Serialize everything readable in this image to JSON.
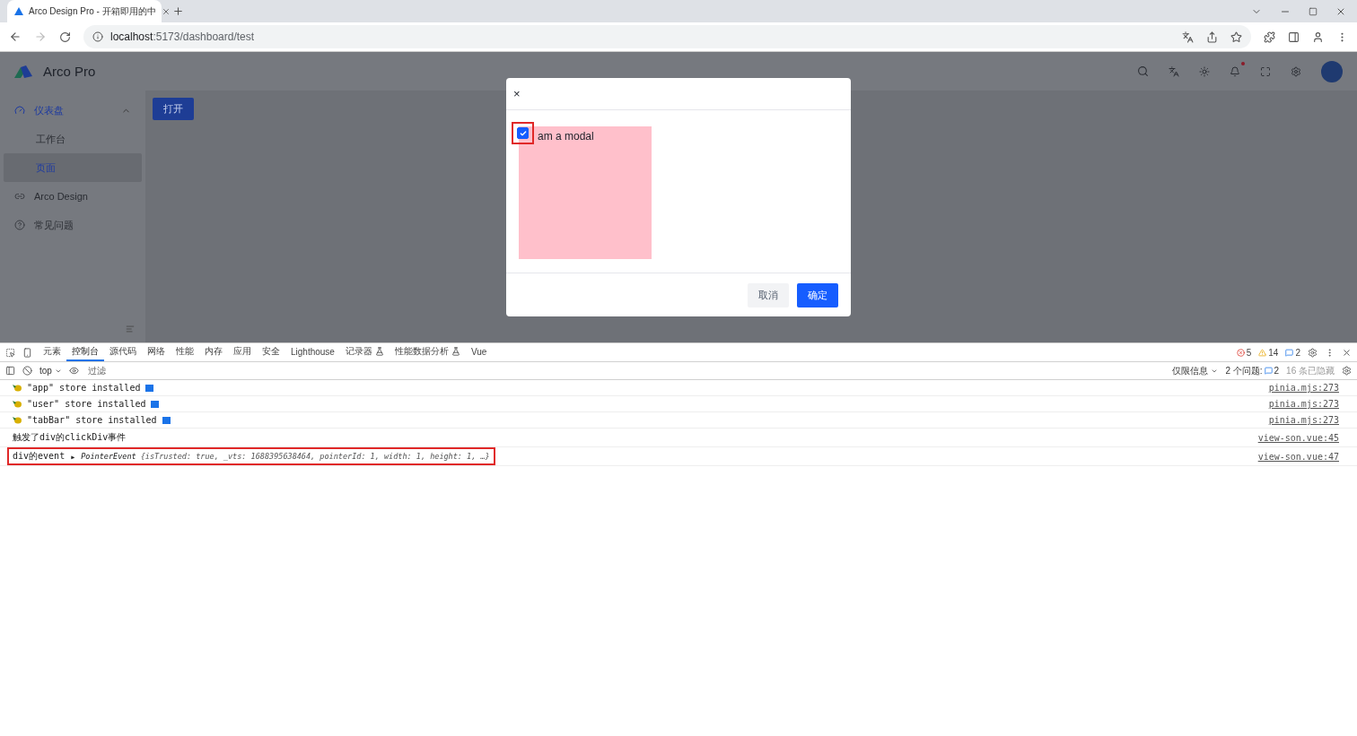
{
  "browser": {
    "tab_title": "Arco Design Pro - 开箱即用的中",
    "url_host": "localhost",
    "url_path": ":5173/dashboard/test"
  },
  "app": {
    "brand": "Arco Pro",
    "notification_dot": true,
    "sidebar": [
      {
        "label": "仪表盘",
        "kind": "group",
        "selected": false,
        "expanded": true,
        "children": [
          {
            "label": "工作台",
            "selected": false
          },
          {
            "label": "页面",
            "selected": true
          }
        ]
      },
      {
        "label": "Arco Design",
        "kind": "item",
        "selected": false
      },
      {
        "label": "常见问题",
        "kind": "item",
        "selected": false
      }
    ],
    "open_button": "打开"
  },
  "modal": {
    "close": "×",
    "checkbox": {
      "label": "am a modal",
      "checked": true,
      "highlighted": true
    },
    "buttons": [
      {
        "label": "取消",
        "kind": "secondary"
      },
      {
        "label": "确定",
        "kind": "primary"
      }
    ]
  },
  "devtools": {
    "tabs": [
      {
        "label": "元素",
        "selected": false,
        "experimental": false
      },
      {
        "label": "控制台",
        "selected": true,
        "experimental": false
      },
      {
        "label": "源代码",
        "selected": false,
        "experimental": false
      },
      {
        "label": "网络",
        "selected": false,
        "experimental": false
      },
      {
        "label": "性能",
        "selected": false,
        "experimental": false
      },
      {
        "label": "内存",
        "selected": false,
        "experimental": false
      },
      {
        "label": "应用",
        "selected": false,
        "experimental": false
      },
      {
        "label": "安全",
        "selected": false,
        "experimental": false
      },
      {
        "label": "Lighthouse",
        "selected": false,
        "experimental": false
      },
      {
        "label": "记录器",
        "selected": false,
        "experimental": true
      },
      {
        "label": "性能数据分析",
        "selected": false,
        "experimental": true
      },
      {
        "label": "Vue",
        "selected": false,
        "experimental": false
      }
    ],
    "errors": "5",
    "warnings": "14",
    "infos": "2",
    "context": "top",
    "filter_placeholder": "过滤",
    "levels": "仅限信息",
    "issues_label": "2 个问题:",
    "issues_count": "2",
    "hidden": "16 条已隐藏",
    "messages": [
      {
        "kind": "store",
        "text": "\"app\" store installed",
        "source": "pinia.mjs:273",
        "highlighted": false
      },
      {
        "kind": "store",
        "text": "\"user\" store installed",
        "source": "pinia.mjs:273",
        "highlighted": false
      },
      {
        "kind": "store",
        "text": "\"tabBar\" store installed",
        "source": "pinia.mjs:273",
        "highlighted": false
      },
      {
        "kind": "plain",
        "text": "触发了div的clickDiv事件",
        "source": "view-son.vue:45",
        "highlighted": false
      },
      {
        "kind": "object",
        "text": "div的event",
        "expander": "▸",
        "type": "PointerEvent",
        "preview": "{isTrusted: true, _vts: 1688395638464, pointerId: 1, width: 1, height: 1, …}",
        "source": "view-son.vue:47",
        "highlighted": true
      }
    ]
  }
}
